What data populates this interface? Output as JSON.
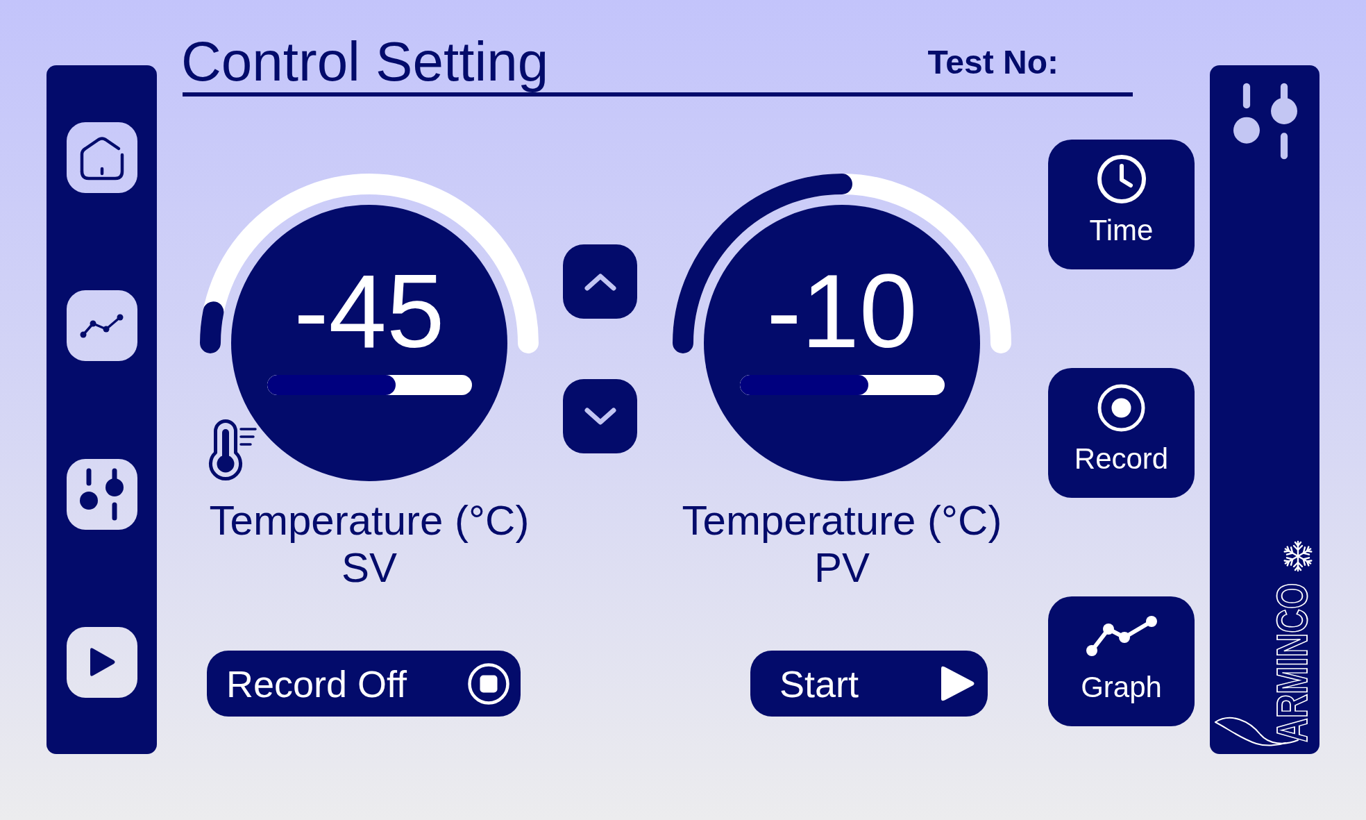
{
  "header": {
    "title": "Control Setting",
    "test_no": "Test No:"
  },
  "gauges": [
    {
      "kind": "setpoint",
      "value": "-45",
      "arc": {
        "level": 0.0625
      },
      "bar": {
        "level": 0.63
      },
      "label": "Temperature (°C)",
      "sublabel": "SV",
      "action": {
        "kind": "stop",
        "label": "Record Off"
      }
    },
    {
      "kind": "process",
      "value": "-10",
      "arc": {
        "level": 0.5
      },
      "bar": {
        "level": 0.63
      },
      "label": "Temperature (°C)",
      "sublabel": "PV",
      "action": {
        "kind": "play",
        "label": "Start"
      }
    }
  ],
  "side_buttons": [
    {
      "kind": "clock",
      "label": "Time"
    },
    {
      "kind": "record",
      "label": "Record"
    },
    {
      "kind": "graph",
      "label": "Graph"
    }
  ],
  "brand": {
    "logo_text": "ARMINCO"
  }
}
